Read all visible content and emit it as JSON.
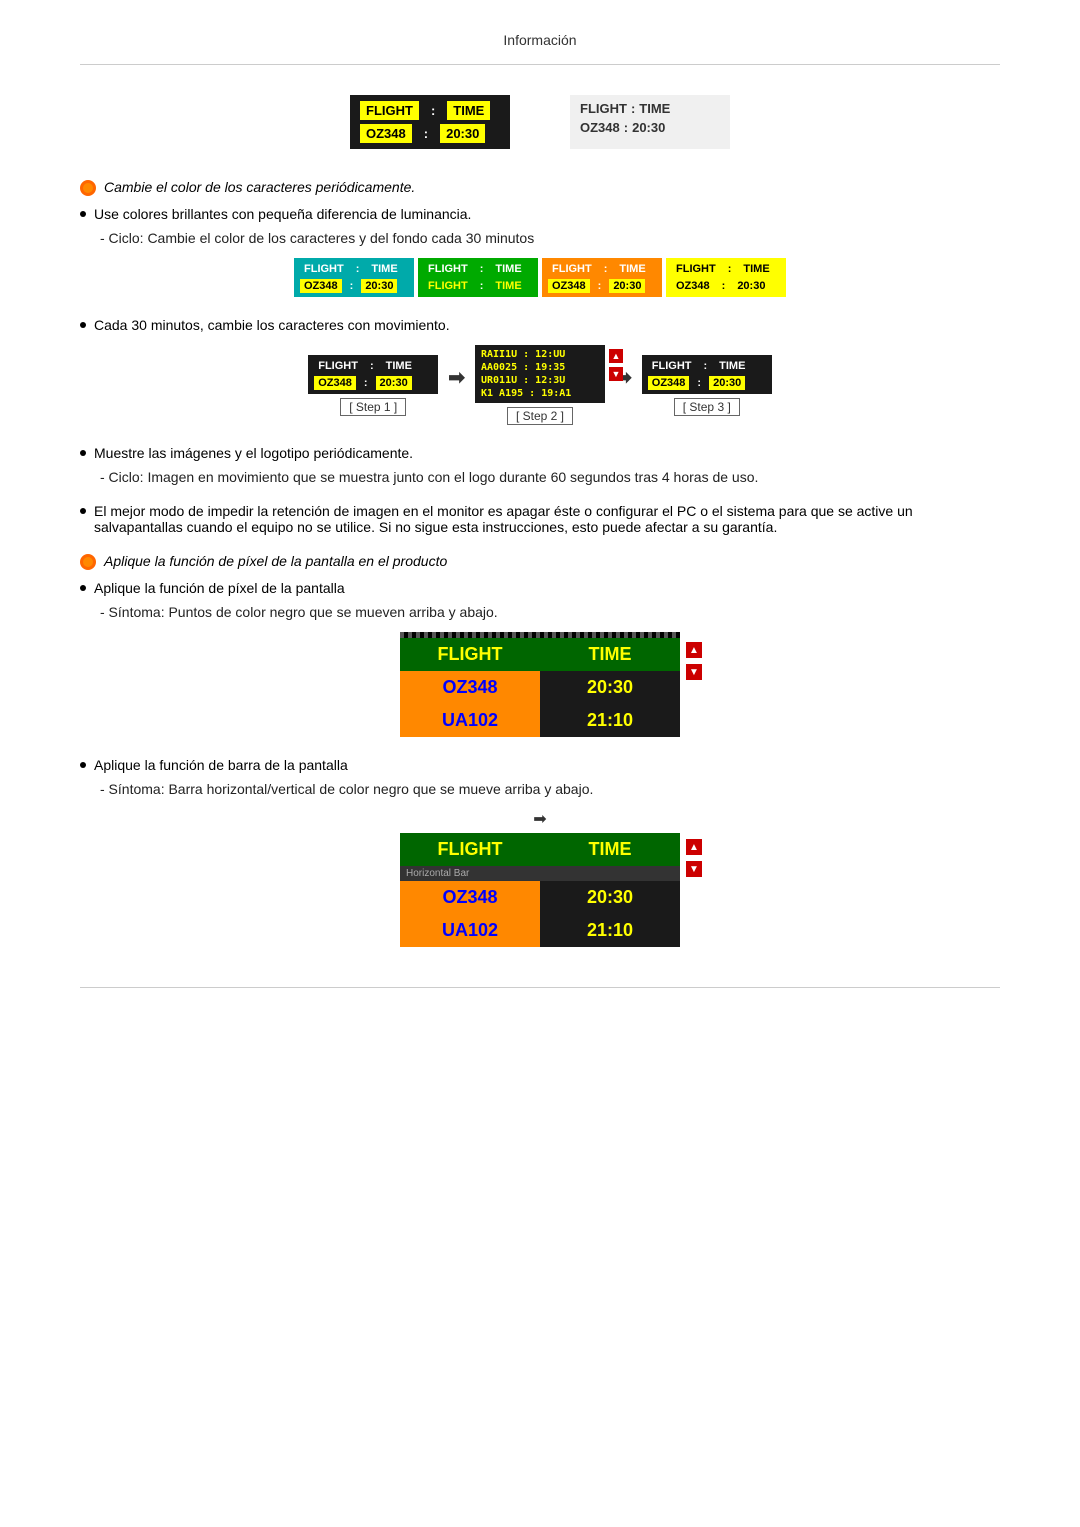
{
  "page": {
    "title": "Información"
  },
  "top_displays": {
    "dark_board": {
      "row1": [
        "FLIGHT",
        ":",
        "TIME"
      ],
      "row2": [
        "OZ348",
        ":",
        "20:30"
      ]
    },
    "light_board": {
      "row1": [
        "FLIGHT",
        ":",
        "TIME"
      ],
      "row2": [
        "OZ348",
        ":",
        "20:30"
      ]
    }
  },
  "sections": {
    "s1_italic": "Cambie el color de los caracteres periódicamente.",
    "s1_bullet1": "Use colores brillantes con pequeña diferencia de luminancia.",
    "s1_sub1": "- Ciclo: Cambie el color de los caracteres y del fondo cada 30 minutos",
    "s2_bullet": "Cada 30 minutos, cambie los caracteres con movimiento.",
    "step1_label": "[ Step 1 ]",
    "step2_label": "[ Step 2 ]",
    "step3_label": "[ Step 3 ]",
    "s3_bullet": "Muestre las imágenes y el logotipo periódicamente.",
    "s3_sub": "- Ciclo: Imagen en movimiento que se muestra junto con el logo durante 60 segundos tras 4 horas de uso.",
    "s4_bullet": "El mejor modo de impedir la retención de imagen en el monitor es apagar éste o configurar el PC o el sistema para que se active un salvapantallas cuando el equipo no se utilice. Si no sigue esta instrucciones, esto puede afectar a su garantía.",
    "s5_italic": "Aplique la función de píxel de la pantalla en el producto",
    "s5_bullet": "Aplique la función de píxel de la pantalla",
    "s5_sub": "- Síntoma: Puntos de color negro que se mueven arriba y abajo.",
    "s6_bullet": "Aplique la función de barra de la pantalla",
    "s6_sub": "- Síntoma: Barra horizontal/vertical de color negro que se mueve arriba y abajo."
  },
  "pixel_board": {
    "header": [
      "FLIGHT",
      "TIME"
    ],
    "row1": [
      "OZ348",
      "20:30"
    ],
    "row2": [
      "UA102",
      "21:10"
    ]
  },
  "bar_board": {
    "header": [
      "FLIGHT",
      "TIME"
    ],
    "bar_label": "Horizontal Bar",
    "row1": [
      "OZ348",
      "20:30"
    ],
    "row2": [
      "UA102",
      "21:10"
    ]
  },
  "cycle_boards": [
    {
      "bg": "cyan",
      "row1": [
        "FLIGHT",
        "TIME"
      ],
      "row2": [
        "OZ348",
        "20:30"
      ],
      "r1style": [
        "white",
        "white",
        "white"
      ],
      "r2style": [
        "yellow",
        "white",
        "yellow"
      ]
    },
    {
      "bg": "green",
      "row1": [
        "FLIGHT",
        "TIME"
      ],
      "row2": [
        "FLIGHT",
        "TIME"
      ],
      "r1style": [
        "white",
        "white",
        "white"
      ],
      "r2style": [
        "white",
        "white",
        "white"
      ]
    },
    {
      "bg": "orange",
      "row1": [
        "FLIGHT",
        "TIME"
      ],
      "row2": [
        "OZ348",
        "20:30"
      ],
      "r1style": [
        "white",
        "white",
        "white"
      ],
      "r2style": [
        "yellow",
        "white",
        "yellow"
      ]
    },
    {
      "bg": "yellow",
      "row1": [
        "FLIGHT",
        "TIME"
      ],
      "row2": [
        "OZ348",
        "20:30"
      ],
      "r1style": [
        "black",
        "black",
        "black"
      ],
      "r2style": [
        "black",
        "white",
        "black"
      ]
    }
  ],
  "steps": {
    "step1": {
      "row1": [
        "FLIGHT",
        ":",
        "TIME"
      ],
      "row2": [
        "OZ348",
        ":",
        "20:30"
      ]
    },
    "step2_scrambled": {
      "row1": "RAII1U : 12:UU",
      "row2": "AA0025 : 19:35",
      "row3": "UR011U : 12:3U",
      "row4": "K1 A195 : 19:A1"
    },
    "step3": {
      "row1": [
        "FLIGHT",
        ":",
        "TIME"
      ],
      "row2": [
        "OZ348",
        ":",
        "20:30"
      ]
    }
  }
}
